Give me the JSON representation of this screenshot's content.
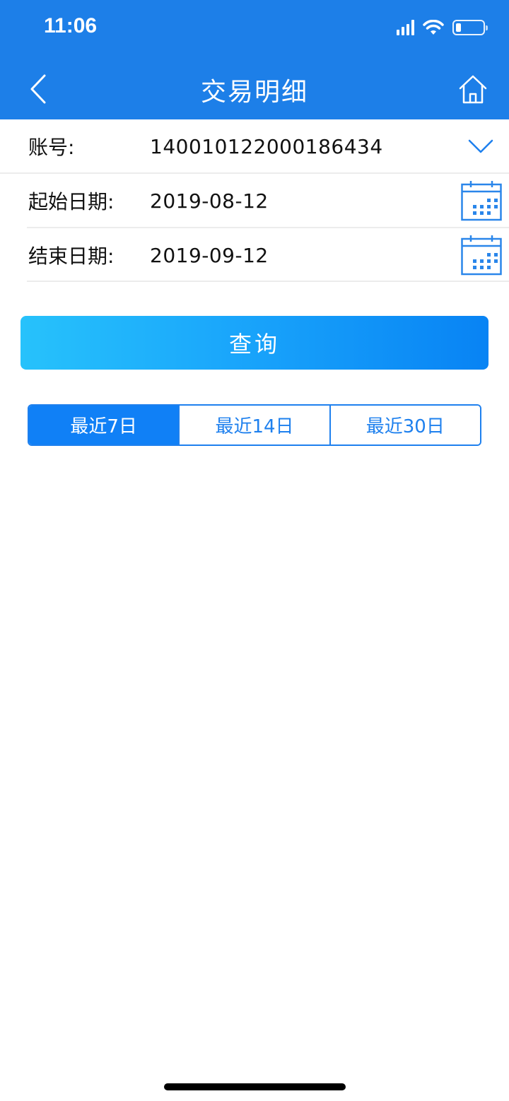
{
  "status_bar": {
    "time": "11:06",
    "battery_level": 0.2
  },
  "header": {
    "title": "交易明细",
    "back_icon": "chevron-left-icon",
    "home_icon": "home-icon"
  },
  "form": {
    "account": {
      "label": "账号:",
      "value": "140010122000186434",
      "icon": "chevron-down-icon"
    },
    "start_date": {
      "label": "起始日期:",
      "value": "2019-08-12",
      "icon": "calendar-icon"
    },
    "end_date": {
      "label": "结束日期:",
      "value": "2019-09-12",
      "icon": "calendar-icon"
    }
  },
  "query_button": {
    "label": "查询"
  },
  "range_tabs": {
    "items": [
      {
        "label": "最近7日",
        "active": true
      },
      {
        "label": "最近14日",
        "active": false
      },
      {
        "label": "最近30日",
        "active": false
      }
    ]
  },
  "colors": {
    "primary": "#1d7fe8",
    "accent": "#1080f6"
  }
}
